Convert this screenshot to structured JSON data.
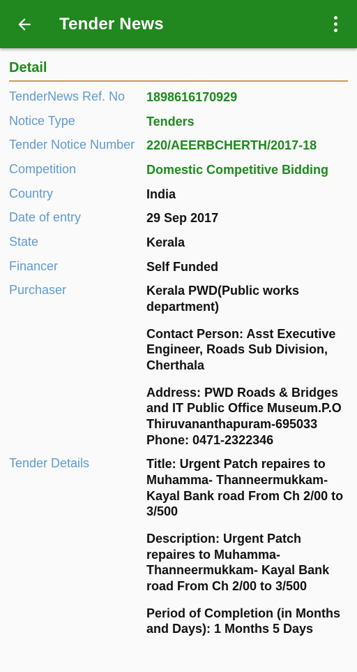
{
  "appbar": {
    "title": "Tender News",
    "back_icon": "arrow-back-icon",
    "overflow_icon": "more-vert-icon"
  },
  "section": {
    "title": "Detail"
  },
  "colors": {
    "header_green": "#21871f",
    "label_blue": "#5e9bd5",
    "value_green": "#1d8a1d",
    "divider_tan": "#c99a5c",
    "background": "#fafafa"
  },
  "rows": [
    {
      "label": "TenderNews Ref. No",
      "value": "1898616170929"
    },
    {
      "label": "Notice Type",
      "value": "Tenders"
    },
    {
      "label": "Tender Notice Number",
      "value": "220/AEERBCHERTH/2017-18"
    },
    {
      "label": "Competition",
      "value": "Domestic Competitive Bidding"
    },
    {
      "label": "Country",
      "value": "India"
    },
    {
      "label": "Date of entry",
      "value": "29 Sep 2017"
    },
    {
      "label": "State",
      "value": "Kerala"
    },
    {
      "label": "Financer",
      "value": "Self Funded"
    }
  ],
  "purchaser": {
    "label": "Purchaser",
    "organisation": "Kerala PWD(Public works department)",
    "contact_person": "Contact Person: Asst Executive Engineer, Roads Sub Division, Cherthala",
    "address": "Address: PWD Roads & Bridges and IT Public Office Museum.P.O Thiruvananthapuram-695033",
    "phone": "Phone: 0471-2322346"
  },
  "tender_details": {
    "label": "Tender Details",
    "title": "Title: Urgent Patch repaires to Muhamma- Thanneermukkam- Kayal Bank road From Ch 2/00 to 3/500",
    "description": "Description: Urgent Patch repaires to Muhamma- Thanneermukkam- Kayal Bank road From Ch 2/00 to 3/500",
    "period": "Period of Completion (in Months and Days): 1 Months 5 Days"
  }
}
